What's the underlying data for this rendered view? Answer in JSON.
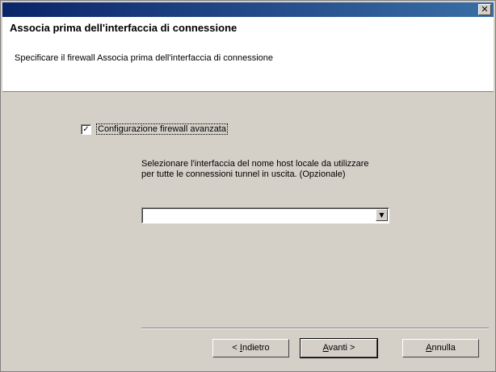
{
  "window": {
    "close_glyph": "✕"
  },
  "header": {
    "title": "Associa prima dell'interfaccia di connessione",
    "subtitle": "Specificare il firewall Associa prima dell'interfaccia di connessione"
  },
  "options": {
    "checkbox_label": "Configurazione firewall avanzata",
    "checkbox_checked": true,
    "checkbox_glyph": "✓",
    "description": "Selezionare l'interfaccia del nome host locale da utilizzare per tutte le connessioni tunnel in uscita. (Opzionale)",
    "interface_value": ""
  },
  "footer": {
    "back_prefix": "< ",
    "back_mnemonic": "I",
    "back_rest": "ndietro",
    "next_mnemonic": "A",
    "next_rest": "vanti >",
    "cancel_mnemonic": "A",
    "cancel_rest": "nnulla"
  },
  "icons": {
    "dropdown_arrow": "▼"
  }
}
